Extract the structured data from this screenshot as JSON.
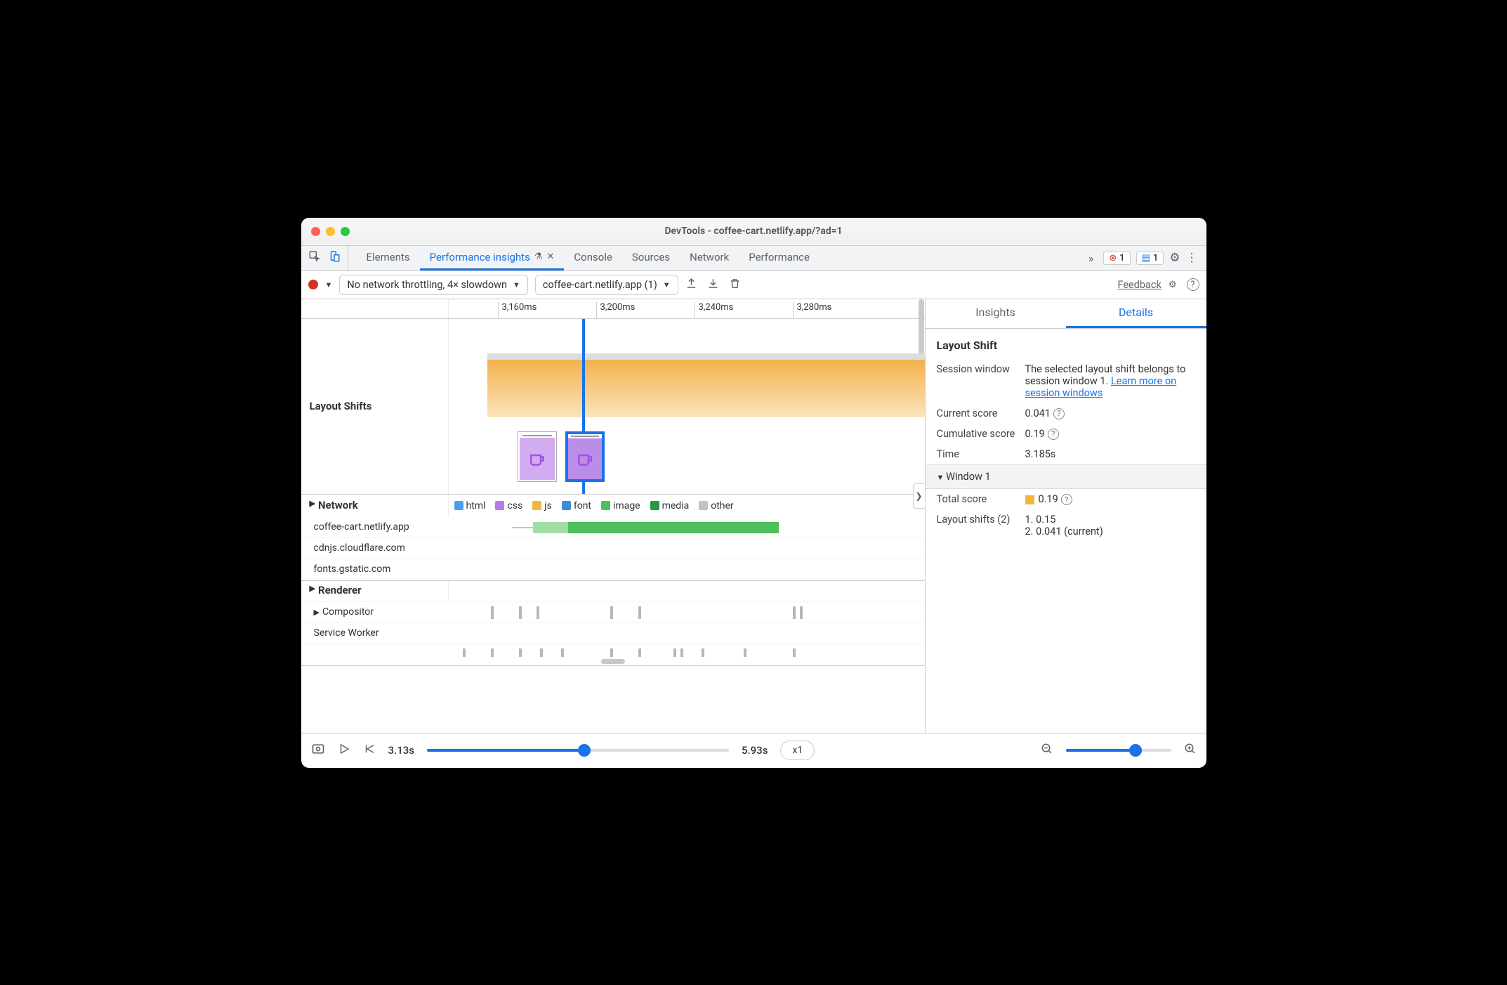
{
  "window": {
    "title": "DevTools - coffee-cart.netlify.app/?ad=1"
  },
  "tabs": {
    "items": [
      "Elements",
      "Performance insights",
      "Console",
      "Sources",
      "Network",
      "Performance"
    ],
    "activeIndex": 1,
    "errorBadge": "1",
    "msgBadge": "1"
  },
  "toolbar": {
    "throttling": "No network throttling, 4× slowdown",
    "recording": "coffee-cart.netlify.app (1)",
    "feedback": "Feedback"
  },
  "ruler": {
    "ticks": [
      "3,160ms",
      "3,200ms",
      "3,240ms",
      "3,280ms"
    ]
  },
  "tracks": {
    "layoutShifts": "Layout Shifts",
    "network": "Network",
    "renderer": "Renderer",
    "compositor": "Compositor",
    "serviceWorker": "Service Worker"
  },
  "legend": [
    "html",
    "css",
    "js",
    "font",
    "image",
    "media",
    "other"
  ],
  "netHosts": [
    "coffee-cart.netlify.app",
    "cdnjs.cloudflare.com",
    "fonts.gstatic.com"
  ],
  "side": {
    "tabs": {
      "insights": "Insights",
      "details": "Details"
    },
    "heading": "Layout Shift",
    "sessionWindow": {
      "label": "Session window",
      "text": "The selected layout shift belongs to session window 1. ",
      "link": "Learn more on session windows"
    },
    "currentScore": {
      "label": "Current score",
      "value": "0.041"
    },
    "cumulativeScore": {
      "label": "Cumulative score",
      "value": "0.19"
    },
    "time": {
      "label": "Time",
      "value": "3.185s"
    },
    "window1": {
      "header": "Window 1",
      "totalScore": {
        "label": "Total score",
        "value": "0.19"
      },
      "layoutShifts": {
        "label": "Layout shifts (2)",
        "items": [
          "1. 0.15",
          "2. 0.041 (current)"
        ]
      }
    }
  },
  "bottom": {
    "start": "3.13s",
    "end": "5.93s",
    "speed": "x1"
  }
}
